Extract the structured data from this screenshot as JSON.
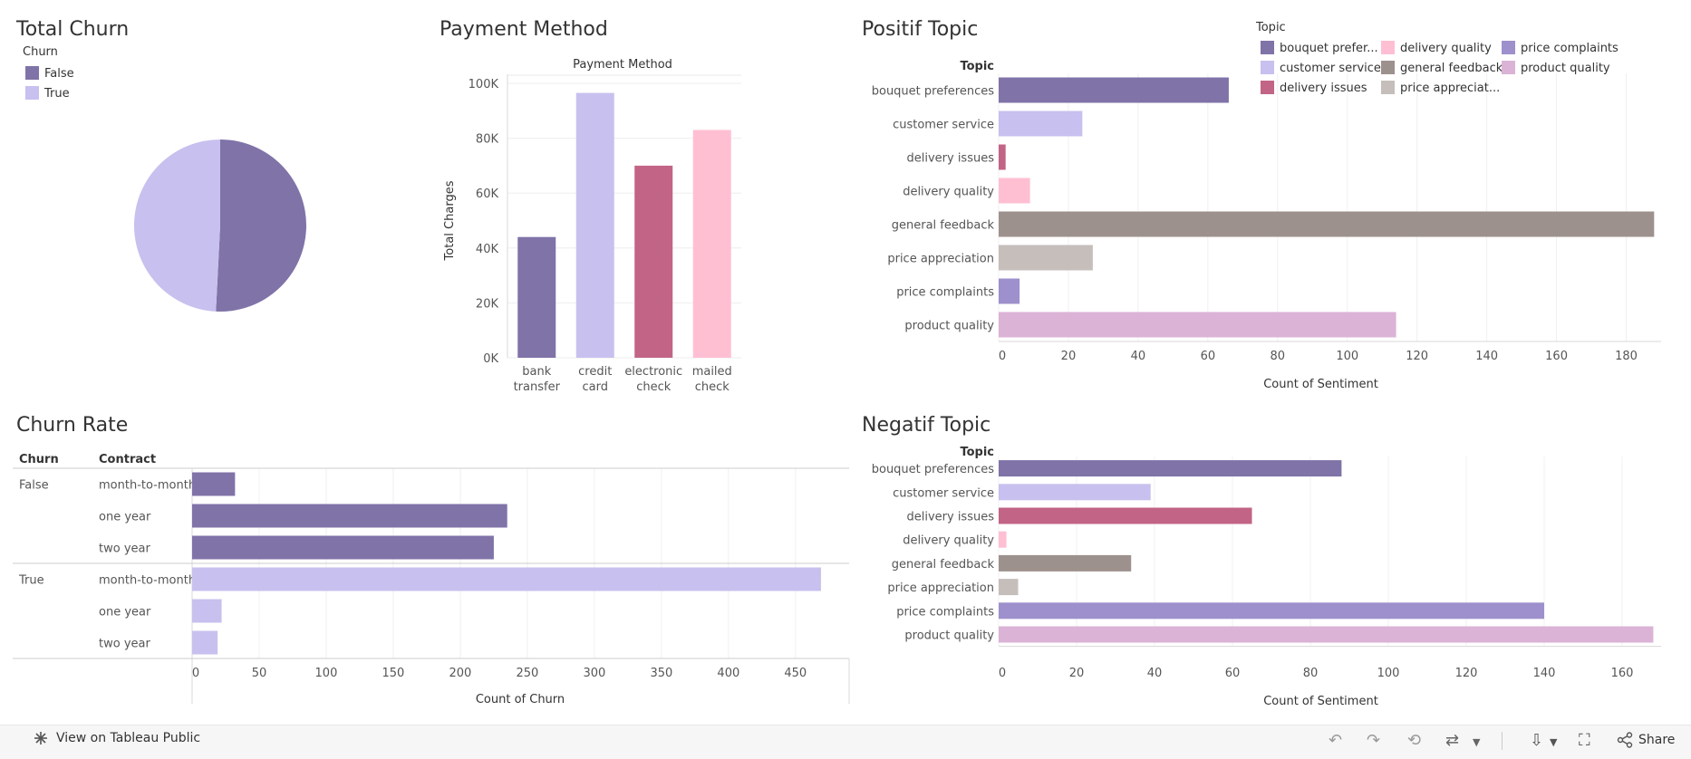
{
  "dashboard": {
    "total_churn_title": "Total Churn",
    "payment_method_title": "Payment Method",
    "positif_topic_title": "Positif Topic",
    "churn_rate_title": "Churn Rate",
    "negatif_topic_title": "Negatif Topic"
  },
  "colors": {
    "bouquet preferences": "#8073a8",
    "customer service": "#c8c0ee",
    "delivery issues": "#c26486",
    "delivery quality": "#ffbfd2",
    "general feedback": "#9d918e",
    "price appreciation": "#c6bebb",
    "price complaints": "#9e90cc",
    "product quality": "#dbb3d6",
    "false": "#8073a8",
    "true": "#c8c0ee"
  },
  "topic_legend": {
    "title": "Topic",
    "items": [
      {
        "key": "bouquet preferences",
        "label": "bouquet prefer..."
      },
      {
        "key": "delivery quality",
        "label": "delivery quality"
      },
      {
        "key": "price complaints",
        "label": "price complaints"
      },
      {
        "key": "customer service",
        "label": "customer service"
      },
      {
        "key": "general feedback",
        "label": "general feedback"
      },
      {
        "key": "product quality",
        "label": "product quality"
      },
      {
        "key": "delivery issues",
        "label": "delivery issues"
      },
      {
        "key": "price appreciation",
        "label": "price appreciat..."
      }
    ]
  },
  "churn_legend": {
    "title": "Churn",
    "items": [
      {
        "key": "false",
        "label": "False"
      },
      {
        "key": "true",
        "label": "True"
      }
    ]
  },
  "chart_data": [
    {
      "id": "total_churn",
      "type": "pie",
      "title": "Total Churn",
      "slices": [
        {
          "label": "False",
          "value": 50.8
        },
        {
          "label": "True",
          "value": 49.2
        }
      ]
    },
    {
      "id": "payment_method",
      "type": "bar",
      "title": "Payment Method",
      "xlabel": "",
      "ylabel": "Total Charges",
      "categories": [
        [
          "bank",
          "transfer"
        ],
        [
          "credit",
          "card"
        ],
        [
          "electronic",
          "check"
        ],
        [
          "mailed",
          "check"
        ]
      ],
      "values": [
        44000,
        96500,
        70000,
        83000
      ],
      "colors": [
        "#8073a8",
        "#c8c0ee",
        "#c26486",
        "#ffbfd2"
      ],
      "ylim": [
        0,
        100000
      ],
      "yticks": [
        0,
        20000,
        40000,
        60000,
        80000,
        100000
      ],
      "ytick_labels": [
        "0K",
        "20K",
        "40K",
        "60K",
        "80K",
        "100K"
      ]
    },
    {
      "id": "positif_topic",
      "type": "bar",
      "orientation": "horizontal",
      "title": "Positif Topic",
      "row_header": "Topic",
      "xlabel": "Count of Sentiment",
      "categories": [
        "bouquet preferences",
        "customer service",
        "delivery issues",
        "delivery quality",
        "general feedback",
        "price appreciation",
        "price complaints",
        "product quality"
      ],
      "values": [
        66,
        24,
        2,
        9,
        188,
        27,
        6,
        114
      ],
      "xlim": [
        0,
        190
      ],
      "xticks": [
        0,
        20,
        40,
        60,
        80,
        100,
        120,
        140,
        160,
        180
      ]
    },
    {
      "id": "churn_rate",
      "type": "bar",
      "orientation": "horizontal",
      "title": "Churn Rate",
      "col_headers": [
        "Churn",
        "Contract"
      ],
      "xlabel": "Count of Churn",
      "groups": [
        {
          "churn": "False",
          "color_key": "false",
          "rows": [
            {
              "contract": "month-to-month",
              "value": 32
            },
            {
              "contract": "one year",
              "value": 235
            },
            {
              "contract": "two year",
              "value": 225
            }
          ]
        },
        {
          "churn": "True",
          "color_key": "true",
          "rows": [
            {
              "contract": "month-to-month",
              "value": 469
            },
            {
              "contract": "one year",
              "value": 22
            },
            {
              "contract": "two year",
              "value": 19
            }
          ]
        }
      ],
      "xlim": [
        0,
        490
      ],
      "xticks": [
        0,
        50,
        100,
        150,
        200,
        250,
        300,
        350,
        400,
        450
      ]
    },
    {
      "id": "negatif_topic",
      "type": "bar",
      "orientation": "horizontal",
      "title": "Negatif Topic",
      "row_header": "Topic",
      "xlabel": "Count of Sentiment",
      "categories": [
        "bouquet preferences",
        "customer service",
        "delivery issues",
        "delivery quality",
        "general feedback",
        "price appreciation",
        "price complaints",
        "product quality"
      ],
      "values": [
        88,
        39,
        65,
        2,
        34,
        5,
        140,
        168
      ],
      "xlim": [
        0,
        170
      ],
      "xticks": [
        0,
        20,
        40,
        60,
        80,
        100,
        120,
        140,
        160
      ]
    }
  ],
  "footer": {
    "view_link": "View on Tableau Public",
    "share_label": "Share",
    "icons": [
      "tableau-logo-icon",
      "undo-icon",
      "redo-icon",
      "revert-icon",
      "refresh-icon",
      "dropdown-icon",
      "download-icon",
      "fullscreen-icon",
      "share-icon"
    ]
  }
}
